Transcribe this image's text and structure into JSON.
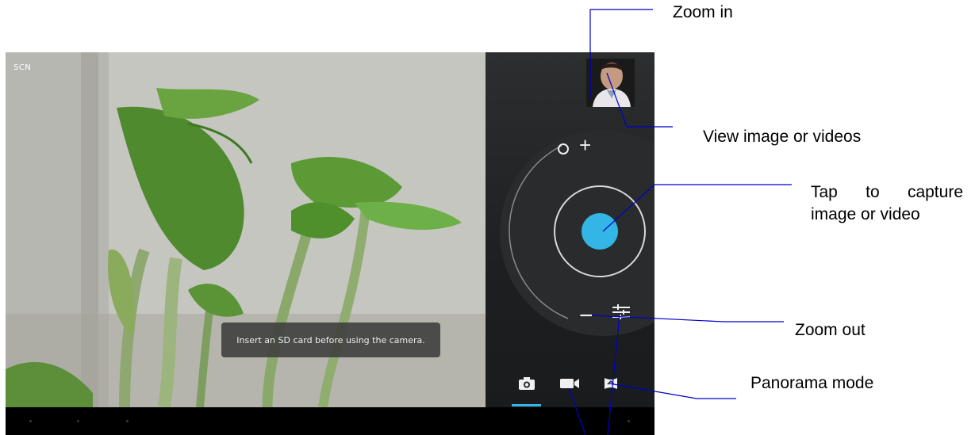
{
  "viewfinder": {
    "scene_mode_label": "SCN",
    "toast_message": "Insert an SD card before using the camera."
  },
  "controls": {
    "zoom_in_symbol": "+",
    "zoom_out_symbol": "−",
    "shutter_color": "#33b5e5",
    "mode_indicator_color": "#33b5e5",
    "modes": [
      {
        "name": "camera-icon",
        "selected": true
      },
      {
        "name": "video-camera-icon",
        "selected": false
      },
      {
        "name": "panorama-icon",
        "selected": false
      }
    ]
  },
  "annotations": {
    "zoom_in": "Zoom in",
    "view_media": "View image or videos",
    "capture_line1": "Tap to capture",
    "capture_line2": "image or video",
    "zoom_out": "Zoom out",
    "panorama": "Panorama mode"
  },
  "colors": {
    "annotation_line": "#0000cc",
    "accent": "#33b5e5"
  }
}
